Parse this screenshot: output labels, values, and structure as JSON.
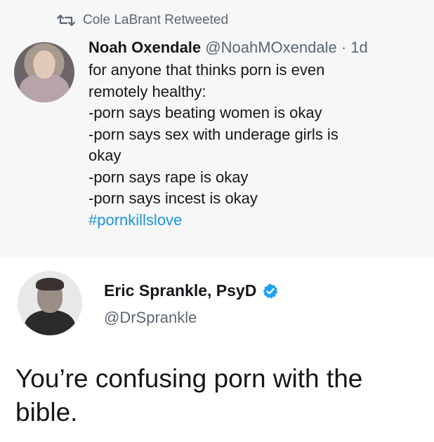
{
  "retweet": {
    "icon": "retweet-icon",
    "label": "Cole LaBrant Retweeted"
  },
  "tweet1": {
    "author_name": "Noah Oxendale",
    "author_handle": "@NoahMOxendale",
    "time": "· 1d",
    "lines": [
      "for anyone that thinks porn is even",
      "remotely healthy:",
      "-porn says beating women is okay",
      "-porn says sex with underage girls is",
      "okay",
      "-porn says rape is okay",
      "-porn says incest is okay"
    ],
    "hashtag": "#pornkillslove"
  },
  "tweet2": {
    "author_name": "Eric Sprankle, PsyD",
    "author_handle": "@DrSprankle",
    "verified_icon": "verified-badge-icon",
    "text": "You’re confusing porn with the bible."
  },
  "colors": {
    "link": "#1b95e0",
    "muted": "#5b6670",
    "text": "#14171a",
    "verified": "#1da1f2"
  }
}
